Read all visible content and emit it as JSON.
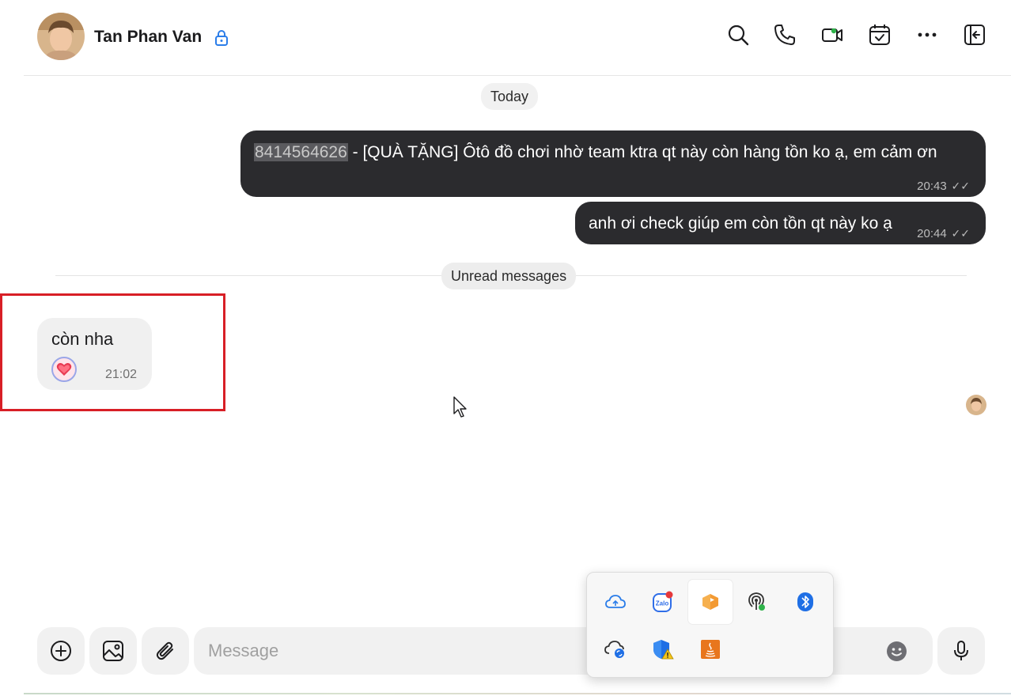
{
  "header": {
    "contact_name": "Tan Phan Van",
    "icons": [
      "search-icon",
      "phone-icon",
      "video-call-icon",
      "calendar-check-icon",
      "more-icon",
      "sidebar-toggle-icon"
    ]
  },
  "chat": {
    "date_separator": "Today",
    "unread_separator": "Unread messages",
    "outgoing": [
      {
        "highlighted": "8414564626",
        "text": " - [QUÀ TẶNG] Ôtô đồ chơi nhờ team ktra qt này còn hàng tồn ko ạ, em cảm ơn",
        "time": "20:43"
      },
      {
        "text": "anh ơi check giúp em còn tồn qt này ko ạ",
        "time": "20:44"
      }
    ],
    "incoming": {
      "text": "còn nha",
      "reaction": "heart",
      "time": "21:02"
    }
  },
  "composer": {
    "placeholder": "Message"
  },
  "tray": {
    "icons": [
      "onedrive-icon",
      "zalo-icon",
      "app-orange-icon",
      "hotspot-icon",
      "bluetooth-icon",
      "cloud-sync-icon",
      "defender-warning-icon",
      "java-icon"
    ]
  },
  "colors": {
    "outgoing_bubble": "#2b2b2e",
    "incoming_bubble": "#f0f0f0",
    "accent_blue": "#2b7de9",
    "highlight_border": "#d81f26"
  }
}
